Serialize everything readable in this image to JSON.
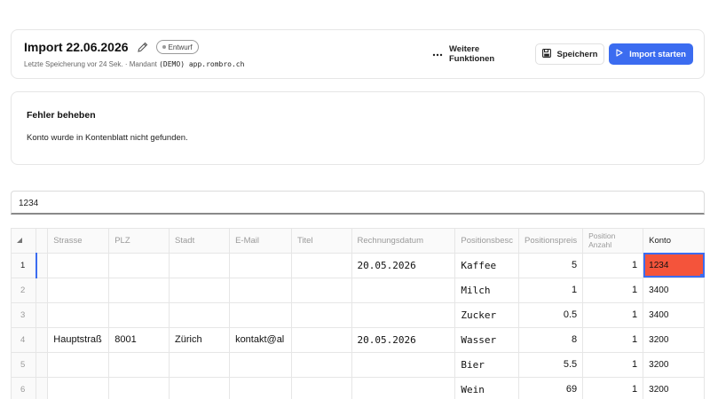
{
  "header": {
    "title": "Import 22.06.2026",
    "status_badge": "Entwurf",
    "last_saved": "Letzte Speicherung vor 24 Sek. · Mandant",
    "mandant_name": "(DEMO) app.rombro.ch",
    "more_label": "Weitere Funktionen",
    "save_label": "Speichern",
    "import_label": "Import starten"
  },
  "error": {
    "title": "Fehler beheben",
    "message": "Konto wurde in Kontenblatt nicht gefunden."
  },
  "cell_editor": {
    "value": "1234"
  },
  "grid": {
    "columns": [
      "",
      "",
      "Strasse",
      "PLZ",
      "Stadt",
      "E-Mail",
      "Titel",
      "Rechnungsdatum",
      "Positionsbesc",
      "Positionspreis",
      "Position Anzahl",
      "Konto"
    ],
    "rows": [
      {
        "n": "1",
        "strasse": "",
        "plz": "",
        "stadt": "",
        "email": "",
        "titel": "",
        "datum": "20.05.2026",
        "beschreibung": "Kaffee",
        "preis": "5",
        "anzahl": "1",
        "konto": "1234"
      },
      {
        "n": "2",
        "strasse": "",
        "plz": "",
        "stadt": "",
        "email": "",
        "titel": "",
        "datum": "",
        "beschreibung": "Milch",
        "preis": "1",
        "anzahl": "1",
        "konto": "3400"
      },
      {
        "n": "3",
        "strasse": "",
        "plz": "",
        "stadt": "",
        "email": "",
        "titel": "",
        "datum": "",
        "beschreibung": "Zucker",
        "preis": "0.5",
        "anzahl": "1",
        "konto": "3400"
      },
      {
        "n": "4",
        "strasse": "Hauptstraß",
        "plz": "8001",
        "stadt": "Zürich",
        "email": "kontakt@al",
        "titel": "",
        "datum": "20.05.2026",
        "beschreibung": "Wasser",
        "preis": "8",
        "anzahl": "1",
        "konto": "3200"
      },
      {
        "n": "5",
        "strasse": "",
        "plz": "",
        "stadt": "",
        "email": "",
        "titel": "",
        "datum": "",
        "beschreibung": "Bier",
        "preis": "5.5",
        "anzahl": "1",
        "konto": "3200"
      },
      {
        "n": "6",
        "strasse": "",
        "plz": "",
        "stadt": "",
        "email": "",
        "titel": "",
        "datum": "",
        "beschreibung": "Wein",
        "preis": "69",
        "anzahl": "1",
        "konto": "3200"
      }
    ]
  },
  "colors": {
    "accent": "#3b6cf0",
    "error_cell": "#f4543b"
  }
}
